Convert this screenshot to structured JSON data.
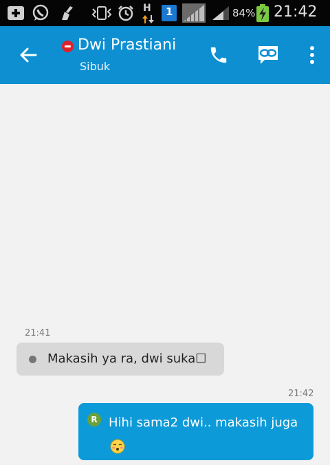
{
  "status_bar": {
    "battery_percent": "84%",
    "time": "21:42",
    "network_type": "H",
    "sim_badge": "1",
    "icons": [
      "add-icon",
      "whatsapp-icon",
      "cleaner-icon",
      "vibrate-icon",
      "alarm-icon",
      "data-arrows-icon",
      "sim-icon",
      "signal-icon",
      "signal-icon",
      "battery-charging-icon"
    ]
  },
  "header": {
    "contact_name": "Dwi Prastiani",
    "contact_status": "Sibuk",
    "presence": "busy",
    "accent_color": "#0d8fd1",
    "actions": [
      "back-icon",
      "phone-icon",
      "video-call-icon",
      "more-icon"
    ]
  },
  "conversation": {
    "messages": [
      {
        "direction": "incoming",
        "time": "21:41",
        "text": "Makasih ya ra, dwi suka☐"
      },
      {
        "direction": "outgoing",
        "time": "21:42",
        "avatar_letter": "R",
        "text": "Hihi sama2 dwi.. makasih juga"
      }
    ]
  }
}
